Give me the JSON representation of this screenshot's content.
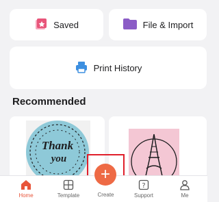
{
  "quick_actions": {
    "saved_label": "Saved",
    "file_import_label": "File & Import",
    "print_history_label": "Print History"
  },
  "recommended": {
    "title": "Recommended",
    "items": [
      {
        "type": "thank-you-sticker",
        "text": "Thank you"
      },
      {
        "type": "eiffel-tower-design"
      }
    ]
  },
  "tabbar": {
    "home": "Home",
    "template": "Template",
    "create": "Create",
    "support": "Support",
    "me": "Me"
  },
  "colors": {
    "accent": "#ee6a45",
    "highlight_border": "#e01e2a",
    "saved_icon": "#e8557a",
    "folder_icon": "#8b5cc6",
    "printer_icon": "#3d8fe0"
  }
}
